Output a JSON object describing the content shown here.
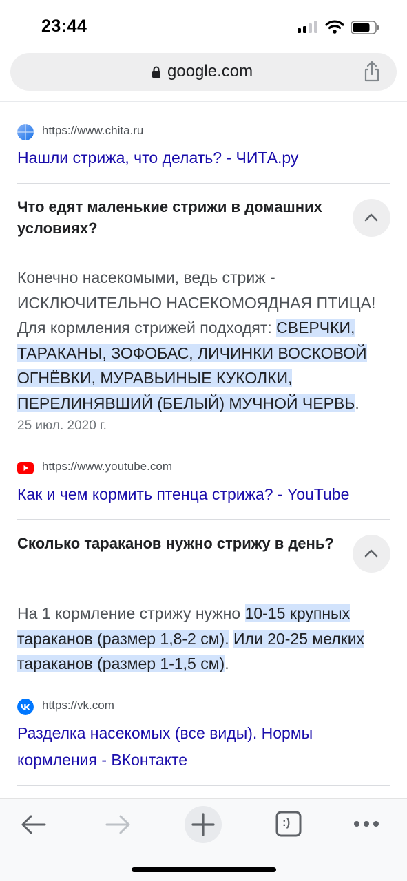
{
  "status_bar": {
    "time": "23:44"
  },
  "url_bar": {
    "domain": "google.com"
  },
  "results": [
    {
      "source_url": "https://www.chita.ru",
      "title": "Нашли стрижа, что делать? - ЧИТА.ру",
      "favicon": "globe-icon"
    },
    {
      "question": "Что едят маленькие стрижи в домашних условиях?",
      "answer_lead": "Конечно насекомыми, ведь стриж - ИСКЛЮЧИТЕЛЬНО НАСЕКОМОЯДНАЯ ПТИЦА! Для кормления стрижей подходят: ",
      "answer_highlight": "СВЕРЧКИ, ТАРАКАНЫ, ЗОФОБАС, ЛИЧИНКИ ВОСКОВОЙ ОГНЁВКИ, МУРАВЬИНЫЕ КУКОЛКИ, ПЕРЕЛИНЯВШИЙ (БЕЛЫЙ) МУЧНОЙ ЧЕРВЬ",
      "answer_tail": ".",
      "date": "25 июл. 2020 г.",
      "source_url": "https://www.youtube.com",
      "title": "Как и чем кормить птенца стрижа? - YouTube",
      "favicon": "youtube-icon"
    },
    {
      "question": "Сколько тараканов нужно стрижу в день?",
      "answer_lead": "На 1 кормление стрижу нужно ",
      "answer_highlight_1": "10-15 крупных тараканов (размер 1,8-2 см).",
      "answer_gap": " ",
      "answer_highlight_2": " Или 20-25 мелких тараканов (размер 1-1,5 см)",
      "answer_tail": ".",
      "source_url": "https://vk.com",
      "title": "Разделка насекомых (все виды). Нормы кормления - ВКонтакте",
      "favicon": "vk-icon"
    }
  ],
  "toolbar": {
    "tab_switcher_label": ":)",
    "icons": [
      "back-arrow-icon",
      "forward-arrow-icon",
      "plus-icon",
      "tab-switcher-icon",
      "more-dots-icon"
    ]
  },
  "colors": {
    "link": "#1a0dab",
    "highlight": "#d2e3fc",
    "youtube_red": "#ff0000",
    "vk_blue": "#0077ff"
  }
}
